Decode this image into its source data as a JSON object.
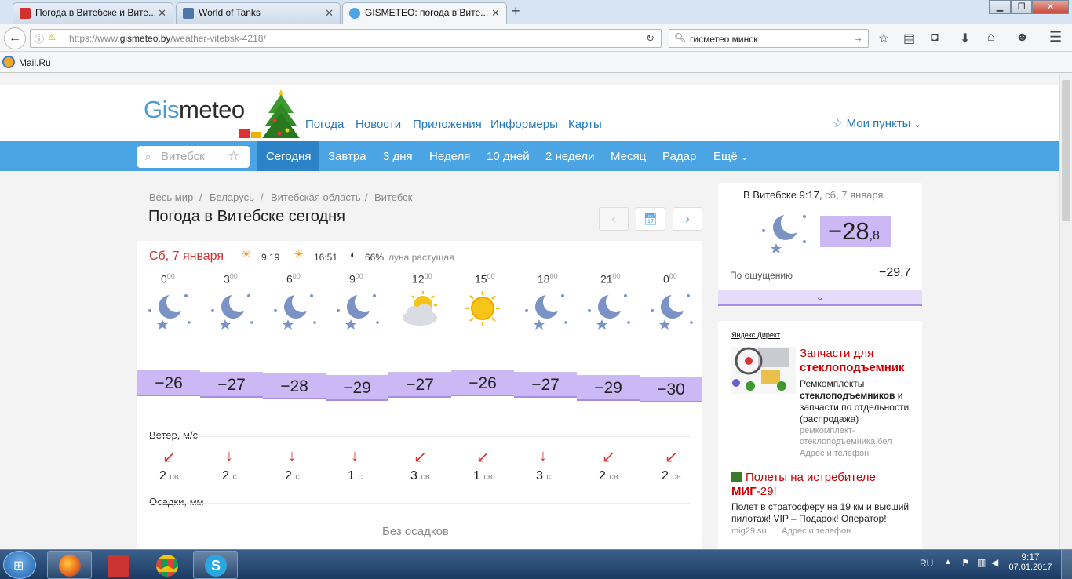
{
  "browser": {
    "tabs": [
      {
        "title": "Погода в Витебске и Вите..."
      },
      {
        "title": "World of Tanks"
      },
      {
        "title": "GISMETEO: погода в Вите..."
      }
    ],
    "url_prefix": "https://www.",
    "url_host": "gismeteo.by",
    "url_path": "/weather-vitebsk-4218/",
    "search_value": "гисметео минск",
    "bookmark": "Mail.Ru"
  },
  "site": {
    "logo_a": "Gis",
    "logo_b": "meteo",
    "nav": [
      "Погода",
      "Новости",
      "Приложения",
      "Информеры",
      "Карты"
    ],
    "my_points": "Мои пункты",
    "city_placeholder": "Витебск",
    "tabs": [
      "Сегодня",
      "Завтра",
      "3 дня",
      "Неделя",
      "10 дней",
      "2 недели",
      "Месяц",
      "Радар",
      "Ещё"
    ],
    "breadcrumbs": [
      "Весь мир",
      "Беларусь",
      "Витебская область",
      "Витебск"
    ],
    "page_title": "Погода в Витебске сегодня"
  },
  "forecast": {
    "date": "Сб, 7 января",
    "sunrise": "9:19",
    "sunset": "16:51",
    "moon_pct": "66%",
    "moon_phase": "луна растущая",
    "hours": [
      {
        "h": "0",
        "m": "00",
        "icon": "moon-stars-icon",
        "temp": "−26",
        "wind": "2",
        "dir": "св",
        "arrow": "↙"
      },
      {
        "h": "3",
        "m": "00",
        "icon": "moon-stars-icon",
        "temp": "−27",
        "wind": "2",
        "dir": "с",
        "arrow": "↓"
      },
      {
        "h": "6",
        "m": "00",
        "icon": "moon-stars-icon",
        "temp": "−28",
        "wind": "2",
        "dir": "с",
        "arrow": "↓"
      },
      {
        "h": "9",
        "m": "00",
        "icon": "moon-stars-icon",
        "temp": "−29",
        "wind": "1",
        "dir": "с",
        "arrow": "↓"
      },
      {
        "h": "12",
        "m": "00",
        "icon": "sun-cloud-icon",
        "temp": "−27",
        "wind": "3",
        "dir": "св",
        "arrow": "↙"
      },
      {
        "h": "15",
        "m": "00",
        "icon": "sun-icon",
        "temp": "−26",
        "wind": "1",
        "dir": "св",
        "arrow": "↙"
      },
      {
        "h": "18",
        "m": "00",
        "icon": "moon-stars-icon",
        "temp": "−27",
        "wind": "3",
        "dir": "с",
        "arrow": "↓"
      },
      {
        "h": "21",
        "m": "00",
        "icon": "moon-stars-icon",
        "temp": "−29",
        "wind": "2",
        "dir": "св",
        "arrow": "↙"
      },
      {
        "h": "0",
        "m": "00",
        "icon": "moon-stars-icon",
        "temp": "−30",
        "wind": "2",
        "dir": "св",
        "arrow": "↙"
      }
    ],
    "wind_label": "Ветер, м/с",
    "precip_label": "Осадки, мм",
    "no_precip": "Без осадков"
  },
  "current": {
    "title_place": "В Витебске 9:17,",
    "title_date": "сб, 7 января",
    "temp_int": "−28",
    "temp_dec": ",8",
    "feels_label": "По ощущению",
    "feels_value": "−29,7"
  },
  "ads": {
    "label": "Яндекс.Директ",
    "ad1_title_a": "Запчасти для",
    "ad1_title_b": "стеклоподъемник",
    "ad1_text_a": "Ремкомплекты",
    "ad1_text_b": "стеклоподъемников",
    "ad1_text_c": "и запчасти по отдельности (распродажа)",
    "ad1_url": "ремкомплект-стеклоподъемника.бел",
    "ad1_contact": "Адрес и телефон",
    "ad2_title_a": "Полеты на истребителе",
    "ad2_title_b": "МИГ",
    "ad2_title_c": "-29!",
    "ad2_text": "Полет в стратосферу на 19 км и высший пилотаж! VIP – Подарок! Оператор!",
    "ad2_url": "mig29.su",
    "ad2_contact": "Адрес и телефон"
  },
  "taskbar": {
    "lang": "RU",
    "time": "9:17",
    "date": "07.01.2017"
  },
  "colors": {
    "accent": "#4ba4e4",
    "temp_band": "#cbb8f5",
    "wind_arrow": "#dd3333"
  }
}
